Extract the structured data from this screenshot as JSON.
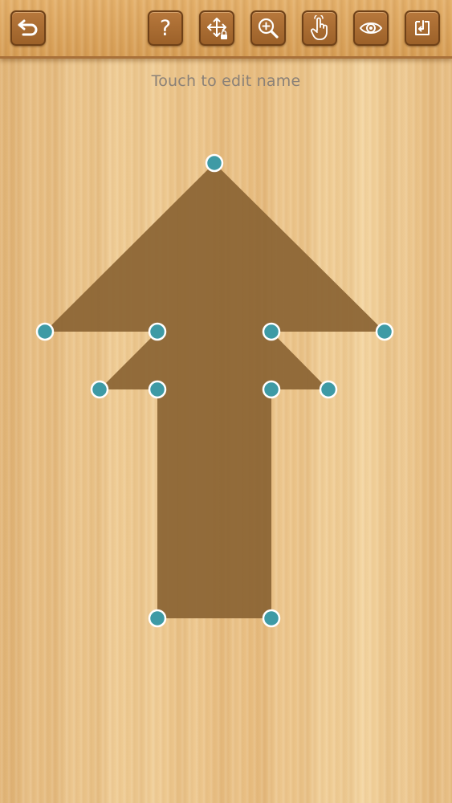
{
  "toolbar": {
    "buttons": [
      {
        "id": "undo",
        "icon": "undo-arrow-icon"
      },
      {
        "id": "help",
        "icon": "question-mark-icon"
      },
      {
        "id": "move",
        "icon": "move-locked-icon"
      },
      {
        "id": "zoom",
        "icon": "zoom-in-icon"
      },
      {
        "id": "touch",
        "icon": "hand-pointer-icon"
      },
      {
        "id": "preview",
        "icon": "eye-icon"
      },
      {
        "id": "save",
        "icon": "save-export-icon"
      }
    ],
    "help_glyph": "?"
  },
  "shape": {
    "name_prompt": "Touch to edit name",
    "fill_color": "#8b6434",
    "handle_color": "#3e9aa5",
    "handle_border_color": "#ffffff"
  }
}
